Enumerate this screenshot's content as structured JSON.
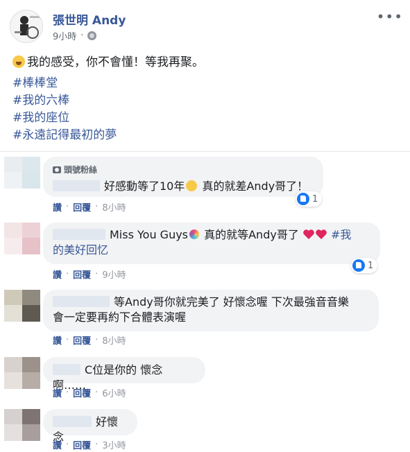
{
  "post": {
    "author": "張世明 Andy",
    "time": "9小時",
    "icons": {
      "avatar": "avatar",
      "privacy": "globe-icon",
      "more": "more-icon"
    },
    "text": "我的感受，你不會懂！等我再聚。",
    "hashtags": [
      "#棒棒堂",
      "#我的六棒",
      "#我的座位",
      "#永遠記得最初的夢"
    ]
  },
  "actions": {
    "like": "讚",
    "reply": "回覆",
    "dot": "·"
  },
  "comments": [
    {
      "badge": "頭號粉絲",
      "text_before": "好感動等了10年",
      "text_after": " 真的就差Andy哥了！",
      "reaction_count": "1",
      "time": "8小時"
    },
    {
      "text_before": "Miss You Guys",
      "text_after": " 真的就等Andy哥了 ",
      "link_line1": " #我",
      "link_line2": "的美好回忆",
      "reaction_count": "1",
      "time": "9小時"
    },
    {
      "text_line1": "等Andy哥你就完美了 好懷念喔 下次最強音音樂",
      "text_line2": "會一定要再約下合體表演喔",
      "time": "8小時"
    },
    {
      "text": "C位是你的 懷念啊……",
      "time": "6小時"
    },
    {
      "text": "好懷念",
      "time": "3小時"
    }
  ],
  "colors": {
    "link": "#385898",
    "bubble": "#f2f3f5",
    "like_blue": "#1877f2",
    "heart_red": "#e0245e"
  }
}
